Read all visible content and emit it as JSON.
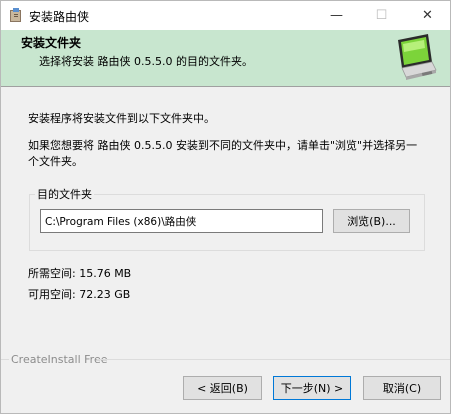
{
  "window": {
    "title": "安装路由侠",
    "minimize_label": "—",
    "maximize_label": "☐",
    "close_label": "✕"
  },
  "header": {
    "title": "安装文件夹",
    "subtitle": "选择将安装 路由侠 0.5.5.0 的目的文件夹。",
    "image_icon": "computer-monitor-icon"
  },
  "body": {
    "intro": "安装程序将安装文件到以下文件夹中。",
    "instructions": "如果您想要将 路由侠 0.5.5.0 安装到不同的文件夹中，请单击\"浏览\"并选择另一个文件夹。"
  },
  "destination": {
    "group_label": "目的文件夹",
    "path_value": "C:\\Program Files (x86)\\路由侠",
    "browse_label": "浏览(B)..."
  },
  "space": {
    "required": "所需空间: 15.76 MB",
    "available": "可用空间: 72.23 GB"
  },
  "footer": {
    "brand": "CreateInstall Free",
    "back_label": "< 返回(B)",
    "next_label": "下一步(N) >",
    "cancel_label": "取消(C)"
  },
  "colors": {
    "header_bg": "#c8e6cf",
    "default_button_border": "#0078d7"
  }
}
